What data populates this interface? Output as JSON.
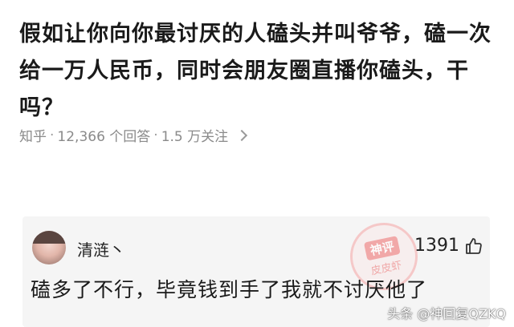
{
  "question": {
    "title": "假如让你向你最讨厌的人磕头并叫爷爷，磕一次给一万人民币，同时会朋友圈直播你磕头，干吗？"
  },
  "meta": {
    "source": "知乎",
    "answers": "12,366 个回答",
    "followers": "1.5 万关注",
    "separator": "·"
  },
  "answer": {
    "author": "清涟丶",
    "like_count": "1391",
    "text": "磕多了不行，毕竟钱到手了我就不讨厌他了"
  },
  "stamp": {
    "line1": "神评",
    "line2": "皮皮虾"
  },
  "watermark": "头条 @神回复QZKQ",
  "icons": {
    "like": "thumbs-up-icon",
    "chevron": "chevron-right-icon",
    "avatar": "user-avatar"
  }
}
